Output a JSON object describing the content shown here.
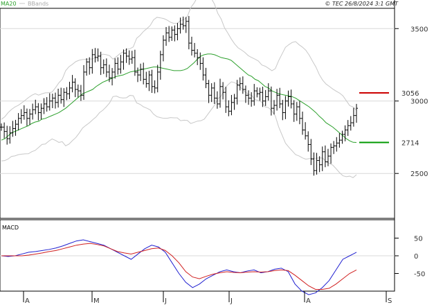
{
  "header": {
    "ma_label": "MA20",
    "bb_label": "BBands",
    "copyright": "© TEC 26/8/2024 3:1 GMT"
  },
  "macd_panel": {
    "title": "MACD"
  },
  "colors": {
    "ma": "#2ca02c",
    "bbands": "#c8c8c8",
    "price": "#000000",
    "resistance": "#cc0000",
    "support": "#009900",
    "macd": "#1f1fd0",
    "signal": "#d01f1f",
    "grid": "#d8d8d8"
  },
  "chart_data": [
    {
      "type": "ohlc",
      "title": "",
      "y_ticks": [
        2500,
        3000,
        3500
      ],
      "ylim": [
        2190,
        3640
      ],
      "x_month_labels": [
        "A",
        "M",
        "J",
        "J",
        "A",
        "S"
      ],
      "x_index_range": [
        0,
        170
      ],
      "grid": true,
      "levels": [
        {
          "label": "3056",
          "value": 3056,
          "color": "#cc0000"
        },
        {
          "label": "2714",
          "value": 2714,
          "color": "#009900"
        }
      ],
      "closes": [
        2820,
        2790,
        2740,
        2780,
        2810,
        2840,
        2880,
        2900,
        2920,
        2880,
        2910,
        2940,
        2960,
        2920,
        2950,
        2980,
        2960,
        3000,
        3020,
        2990,
        3040,
        3010,
        3060,
        3050,
        3090,
        3130,
        3080,
        3070,
        3040,
        3200,
        3270,
        3230,
        3320,
        3300,
        3310,
        3230,
        3250,
        3200,
        3160,
        3200,
        3260,
        3220,
        3270,
        3330,
        3310,
        3290,
        3300,
        3200,
        3180,
        3220,
        3150,
        3120,
        3180,
        3100,
        3090,
        3200,
        3320,
        3420,
        3470,
        3440,
        3490,
        3460,
        3500,
        3530,
        3520,
        3550,
        3400,
        3350,
        3330,
        3300,
        3260,
        3180,
        3120,
        3040,
        3090,
        3020,
        2980,
        3100,
        3060,
        2960,
        2930,
        2990,
        3020,
        3110,
        3120,
        3080,
        3040,
        3020,
        3000,
        3070,
        3050,
        3060,
        3000,
        3030,
        3070,
        2950,
        2970,
        3040,
        2980,
        2920,
        3000,
        3030,
        2980,
        2910,
        2960,
        2880,
        2800,
        2760,
        2700,
        2600,
        2520,
        2590,
        2560,
        2650,
        2580,
        2620,
        2680,
        2690,
        2710,
        2730,
        2770,
        2800,
        2830,
        2850,
        2900,
        2950
      ],
      "ma20": [
        2730,
        2740,
        2760,
        2780,
        2790,
        2800,
        2810,
        2820,
        2830,
        2845,
        2855,
        2860,
        2875,
        2880,
        2890,
        2900,
        2910,
        2920,
        2935,
        2950,
        2970,
        2990,
        3010,
        3030,
        3050,
        3060,
        3070,
        3080,
        3100,
        3115,
        3130,
        3140,
        3150,
        3160,
        3170,
        3175,
        3180,
        3190,
        3200,
        3205,
        3210,
        3215,
        3220,
        3225,
        3230,
        3235,
        3235,
        3230,
        3225,
        3220,
        3215,
        3210,
        3210,
        3210,
        3215,
        3225,
        3245,
        3265,
        3290,
        3310,
        3320,
        3325,
        3325,
        3320,
        3310,
        3300,
        3295,
        3290,
        3280,
        3260,
        3240,
        3220,
        3200,
        3180,
        3170,
        3150,
        3140,
        3120,
        3100,
        3090,
        3070,
        3060,
        3050,
        3045,
        3040,
        3035,
        3030,
        3020,
        3005,
        2990,
        2975,
        2960,
        2940,
        2920,
        2895,
        2875,
        2850,
        2835,
        2820,
        2800,
        2780,
        2760,
        2740,
        2725,
        2715,
        2714
      ]
    },
    {
      "type": "line",
      "title": "MACD",
      "y_ticks": [
        50,
        0,
        -50
      ],
      "ylim": [
        -100,
        100
      ],
      "series": [
        {
          "values": [
            0,
            -2,
            0,
            5,
            10,
            12,
            15,
            18,
            22,
            28,
            35,
            42,
            45,
            40,
            35,
            30,
            20,
            10,
            0,
            -10,
            5,
            20,
            30,
            25,
            10,
            -20,
            -50,
            -75,
            -90,
            -80,
            -65,
            -55,
            -45,
            -40,
            -45,
            -48,
            -43,
            -40,
            -48,
            -45,
            -38,
            -35,
            -45,
            -80,
            -100,
            -110,
            -105,
            -90,
            -70,
            -40,
            -10,
            0,
            10
          ]
        },
        {
          "values": [
            0,
            0,
            0,
            0,
            2,
            5,
            8,
            12,
            15,
            20,
            25,
            30,
            33,
            35,
            32,
            28,
            20,
            12,
            8,
            5,
            10,
            15,
            20,
            22,
            15,
            0,
            -20,
            -45,
            -60,
            -65,
            -58,
            -52,
            -48,
            -45,
            -47,
            -48,
            -46,
            -45,
            -46,
            -45,
            -42,
            -40,
            -42,
            -55,
            -70,
            -85,
            -95,
            -95,
            -92,
            -80,
            -65,
            -50,
            -40
          ]
        }
      ]
    }
  ]
}
